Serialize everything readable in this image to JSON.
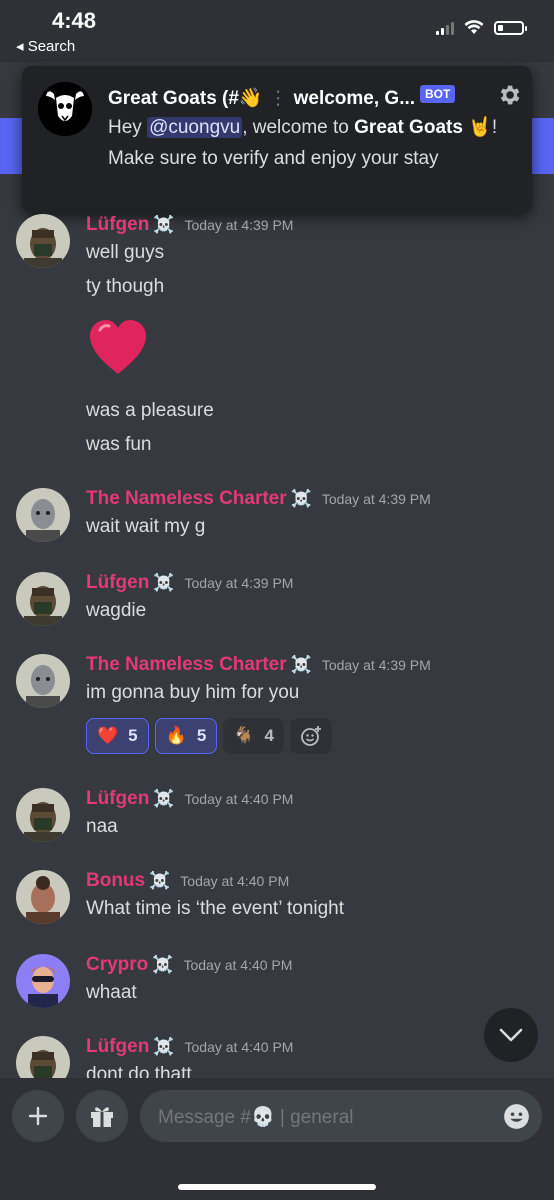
{
  "status_bar": {
    "time": "4:48",
    "back_label": "◂ Search"
  },
  "notification": {
    "server": "Great Goats (#👋",
    "channel": "welcome, G...",
    "badge": "BOT",
    "body_before": "Hey ",
    "mention": "@cuongvu",
    "body_mid": ", welcome to ",
    "server_bold": "Great Goats",
    "body_after": " 🤘! Make sure to verify and enjoy your stay"
  },
  "messages": [
    {
      "author": "Lüfgen",
      "badge": "☠️",
      "time": "Today at 4:39 PM",
      "lines": [
        "well guys",
        "ty though",
        "was a pleasure",
        "was fun"
      ]
    },
    {
      "author": "The Nameless Charter",
      "badge": "☠️",
      "time": "Today at 4:39 PM",
      "text": "wait wait my g"
    },
    {
      "author": "Lüfgen",
      "badge": "☠️",
      "time": "Today at 4:39 PM",
      "text": "wagdie"
    },
    {
      "author": "The Nameless Charter",
      "badge": "☠️",
      "time": "Today at 4:39 PM",
      "text": "im gonna buy him for you",
      "reactions": [
        {
          "emoji": "❤️",
          "count": "5",
          "me": true
        },
        {
          "emoji": "🔥",
          "count": "5",
          "me": true
        },
        {
          "emoji": "🐐",
          "count": "4",
          "me": false
        }
      ]
    },
    {
      "author": "Lüfgen",
      "badge": "☠️",
      "time": "Today at 4:40 PM",
      "text": "naa"
    },
    {
      "author": "Bonus",
      "badge": "☠️",
      "time": "Today at 4:40 PM",
      "text": "What time is ‘the event’ tonight"
    },
    {
      "author": "Crypro",
      "badge": "☠️",
      "time": "Today at 4:40 PM",
      "text": "whaat"
    },
    {
      "author": "Lüfgen",
      "badge": "☠️",
      "time": "Today at 4:40 PM",
      "text": "dont do thatt"
    }
  ],
  "composer": {
    "placeholder_prefix": "Message #💀",
    "placeholder_channel": "| general"
  },
  "colors": {
    "background": "#36393f",
    "author": "#e3387a",
    "accent": "#5865f2",
    "bot_badge": "#5865f2"
  },
  "icons": [
    "signal-icon",
    "wifi-icon",
    "battery-icon",
    "gear-icon",
    "heart-emoji",
    "add-reaction-icon",
    "chevron-down-icon",
    "plus-icon",
    "gift-icon",
    "emoji-icon"
  ]
}
